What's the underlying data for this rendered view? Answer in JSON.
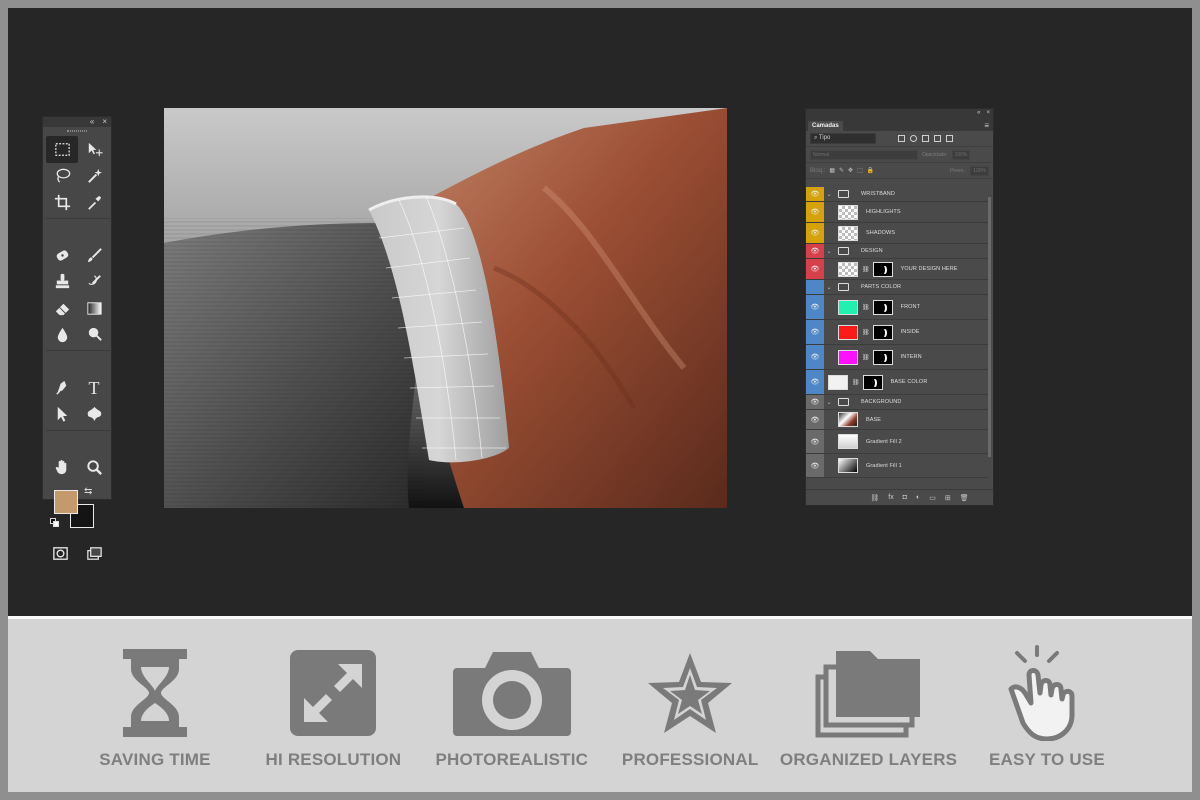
{
  "colors": {
    "frame": "#8f8f8f",
    "workspace": "#262626",
    "panel": "#4a4a4a",
    "feature_gray": "#7a7a7a",
    "foreground_color": "#c49a6c",
    "background_color": "#141414",
    "wristband_group": "#d4a20a",
    "design_group": "#d6404a",
    "parts_group": "#4e86c6",
    "background_group": "#6a6a6a"
  },
  "toolbar": {
    "collapse_glyph": "«",
    "close_glyph": "×",
    "tools": [
      "rectangular-marquee-icon",
      "move-icon",
      "lasso-icon",
      "magic-wand-icon",
      "crop-icon",
      "eyedropper-icon",
      "spot-healing-icon",
      "brush-icon",
      "clone-stamp-icon",
      "history-brush-icon",
      "eraser-icon",
      "gradient-icon",
      "blur-icon",
      "dodge-icon",
      "pen-icon",
      "type-icon",
      "path-selection-icon",
      "custom-shape-icon",
      "hand-icon",
      "zoom-icon"
    ],
    "type_glyph": "T",
    "swap_glyph": "⇆"
  },
  "layers_panel": {
    "tab_label": "Camadas",
    "menu_glyph": "≡",
    "filter_label": "Tipo",
    "blend_mode": "Normal",
    "opacity_label": "Opacidade:",
    "opacity_value": "100%",
    "lock_label": "Bloq.:",
    "fill_label": "Preen.:",
    "fill_value": "100%",
    "eye_glyph": "👁",
    "layers": [
      {
        "name": "WRISTBAND",
        "kind": "group",
        "group": "wristband"
      },
      {
        "name": "HIGHLIGHTS",
        "kind": "layer",
        "group": "wristband"
      },
      {
        "name": "SHADOWS",
        "kind": "layer",
        "group": "wristband"
      },
      {
        "name": "DESIGN",
        "kind": "group",
        "group": "design"
      },
      {
        "name": "YOUR DESIGN HERE",
        "kind": "smart",
        "group": "design"
      },
      {
        "name": "PARTS COLOR",
        "kind": "group",
        "group": "parts"
      },
      {
        "name": "FRONT",
        "kind": "fill",
        "group": "parts",
        "swatch": "#20f0b0"
      },
      {
        "name": "INSIDE",
        "kind": "fill",
        "group": "parts",
        "swatch": "#ff1a1a"
      },
      {
        "name": "INTERN",
        "kind": "fill",
        "group": "parts",
        "swatch": "#ff10ff"
      },
      {
        "name": "BASE COLOR",
        "kind": "fill",
        "group": "parts",
        "swatch": "#f2f2f2"
      },
      {
        "name": "BACKGROUND",
        "kind": "group",
        "group": "background"
      },
      {
        "name": "BASE",
        "kind": "photo",
        "group": "background"
      },
      {
        "name": "Gradient Fill 2",
        "kind": "gradient",
        "group": "background"
      },
      {
        "name": "Gradient Fill 1",
        "kind": "gradient",
        "group": "background"
      }
    ],
    "footer_glyphs": [
      "⛓",
      "fx",
      "◘",
      "◐",
      "▭",
      "⊞",
      "🗑"
    ]
  },
  "features": [
    {
      "label": "SAVING TIME",
      "icon": "hourglass-icon"
    },
    {
      "label": "HI RESOLUTION",
      "icon": "expand-arrows-icon"
    },
    {
      "label": "PHOTOREALISTIC",
      "icon": "camera-icon"
    },
    {
      "label": "PROFESSIONAL",
      "icon": "star-icon"
    },
    {
      "label": "ORGANIZED LAYERS",
      "icon": "stacked-folders-icon"
    },
    {
      "label": "EASY TO USE",
      "icon": "tap-hand-icon"
    }
  ]
}
